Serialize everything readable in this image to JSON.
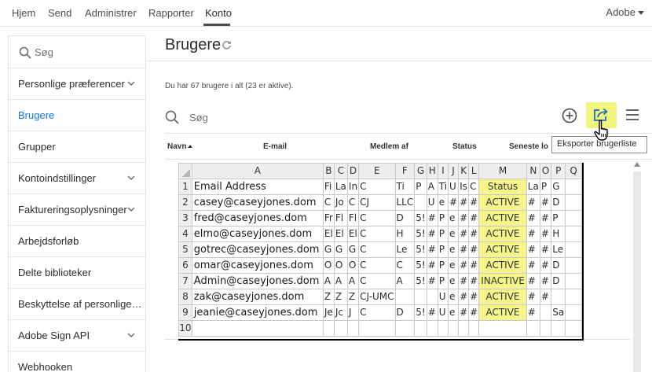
{
  "topnav": {
    "items": [
      {
        "label": "Hjem"
      },
      {
        "label": "Send"
      },
      {
        "label": "Administrer"
      },
      {
        "label": "Rapporter"
      },
      {
        "label": "Konto"
      }
    ],
    "active_index": 4,
    "org_label": "Adobe"
  },
  "sidebar": {
    "search_placeholder": "Søg",
    "items": [
      {
        "label": "Personlige præferencer",
        "expandable": true
      },
      {
        "label": "Brugere",
        "expandable": false,
        "selected": true
      },
      {
        "label": "Grupper",
        "expandable": false
      },
      {
        "label": "Kontoindstillinger",
        "expandable": true
      },
      {
        "label": "Faktureringsoplysninger",
        "expandable": true
      },
      {
        "label": "Arbejdsforløb",
        "expandable": false
      },
      {
        "label": "Delte biblioteker",
        "expandable": false
      },
      {
        "label": "Beskyttelse af personlige o...",
        "expandable": false
      },
      {
        "label": "Adobe Sign API",
        "expandable": true
      },
      {
        "label": "Webhooken",
        "expandable": false
      }
    ]
  },
  "main": {
    "title": "Brugere",
    "summary": "Du har 67 brugere i alt (23 er aktive).",
    "search_placeholder": "Søg",
    "tooltip": "Eksporter brugerliste",
    "columns": [
      "Navn",
      "E-mail",
      "Medlem af",
      "Status",
      "Seneste lo"
    ]
  },
  "spreadsheet": {
    "column_headers": [
      "A",
      "B",
      "C",
      "D",
      "E",
      "F",
      "G",
      "H",
      "I",
      "J",
      "K",
      "L",
      "M",
      "N",
      "O",
      "P",
      "Q"
    ],
    "rows": [
      {
        "n": "1",
        "a": "Email Address",
        "cells": [
          "Fi",
          "La",
          "In",
          "C",
          "Ti",
          "P",
          "A",
          "Ti",
          "U",
          "Is",
          "C"
        ],
        "m": "Status",
        "tail": [
          "La",
          "P",
          "G"
        ]
      },
      {
        "n": "2",
        "a": "casey@caseyjones.dom",
        "cells": [
          "C",
          "Jo",
          "C",
          "CJ",
          "LLC",
          "",
          "U",
          "e",
          "#",
          "#",
          "#"
        ],
        "m": "ACTIVE",
        "tail": [
          "#",
          "#",
          "D"
        ]
      },
      {
        "n": "3",
        "a": "fred@caseyjones.dom",
        "cells": [
          "Fr",
          "Fl",
          "Fl",
          "C",
          "D",
          "5!",
          "#",
          "P",
          "e",
          "#",
          "#"
        ],
        "m": "ACTIVE",
        "tail": [
          "#",
          "#",
          "P"
        ]
      },
      {
        "n": "4",
        "a": "elmo@caseyjones.dom",
        "cells": [
          "El",
          "El",
          "El",
          "C",
          "H",
          "5!",
          "#",
          "P",
          "e",
          "#",
          "#"
        ],
        "m": "ACTIVE",
        "tail": [
          "#",
          "#",
          "H"
        ]
      },
      {
        "n": "5",
        "a": "gotrec@caseyjones.dom",
        "cells": [
          "G",
          "G",
          "G",
          "C",
          "Le",
          "5!",
          "#",
          "P",
          "e",
          "#",
          "#"
        ],
        "m": "ACTIVE",
        "tail": [
          "#",
          "#",
          "Le"
        ]
      },
      {
        "n": "6",
        "a": "omar@caseyjones.dom",
        "cells": [
          "O",
          "O",
          "O",
          "C",
          "C",
          "5!",
          "#",
          "P",
          "e",
          "#",
          "#"
        ],
        "m": "ACTIVE",
        "tail": [
          "#",
          "#",
          "D"
        ]
      },
      {
        "n": "7",
        "a": "Admin@caseyjones.dom",
        "cells": [
          "A",
          "A",
          "A",
          "C",
          "A",
          "5!",
          "#",
          "P",
          "e",
          "#",
          "#"
        ],
        "m": "INACTIVE",
        "tail": [
          "#",
          "#",
          "D"
        ]
      },
      {
        "n": "8",
        "a": "zak@caseyjones.dom",
        "cells": [
          "Z",
          "Z",
          "Z",
          "CJ-UMC",
          "",
          "",
          "",
          "U",
          "e",
          "#",
          "#"
        ],
        "m": "ACTIVE",
        "tail": [
          "#",
          "#",
          ""
        ]
      },
      {
        "n": "9",
        "a": "jeanie@caseyjones.dom",
        "cells": [
          "Je",
          "Jc",
          "J",
          "C",
          "D",
          "5!",
          "#",
          "U",
          "e",
          "#",
          "#"
        ],
        "m": "ACTIVE",
        "tail": [
          "#",
          "",
          "Sa"
        ]
      },
      {
        "n": "10",
        "a": "",
        "cells": [
          "",
          "",
          "",
          "",
          "",
          "",
          "",
          "",
          "",
          "",
          ""
        ],
        "m": "",
        "tail": [
          "",
          "",
          ""
        ]
      }
    ]
  },
  "colors": {
    "accent_blue": "#1473e6",
    "highlight_yellow": "#f0f57e",
    "status_fill": "#f5f58c"
  }
}
